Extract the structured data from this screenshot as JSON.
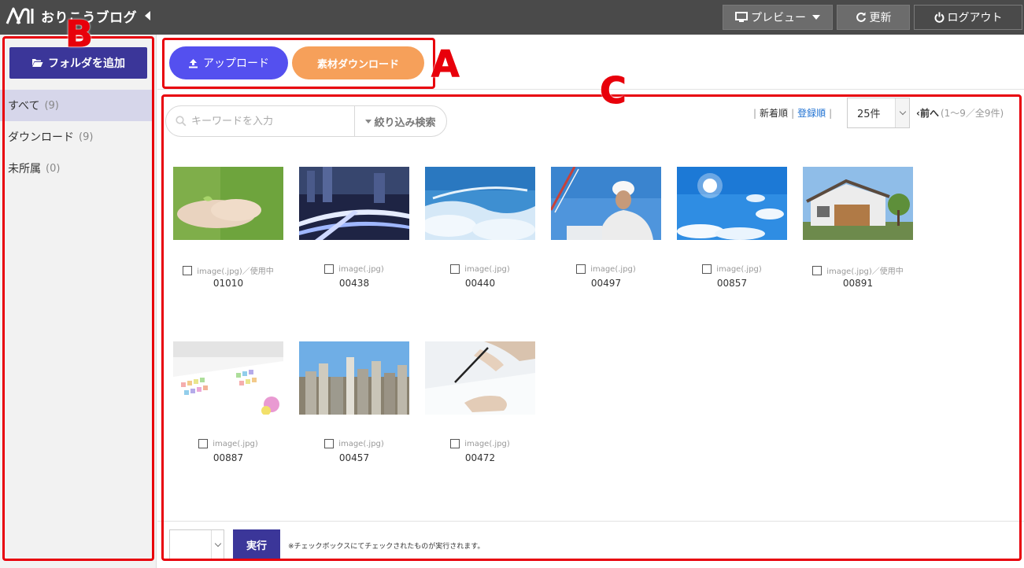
{
  "app": {
    "brand": "おりこうブログ"
  },
  "topbar": {
    "preview_label": "プレビュー",
    "refresh_label": "更新",
    "logout_label": "ログアウト"
  },
  "sidebar": {
    "add_folder_label": "フォルダを追加",
    "folders": [
      {
        "label": "すべて",
        "count": "(9)",
        "active": true
      },
      {
        "label": "ダウンロード",
        "count": "(9)",
        "active": false
      },
      {
        "label": "未所属",
        "count": "(0)",
        "active": false
      }
    ]
  },
  "actions": {
    "upload_label": "アップロード",
    "download_label": "素材ダウンロード"
  },
  "toolbar": {
    "search_placeholder": "キーワードを入力",
    "filter_label": "絞り込み検索",
    "sort_newest": "新着順",
    "sort_registered": "登録順",
    "per_page": "25件",
    "prev_label": "前へ",
    "page_info": "(1〜9／全9件)"
  },
  "images": [
    {
      "type": "image(.jpg)／使用中",
      "name": "01010",
      "art": "hands"
    },
    {
      "type": "image(.jpg)",
      "name": "00438",
      "art": "night-city"
    },
    {
      "type": "image(.jpg)",
      "name": "00440",
      "art": "clouds"
    },
    {
      "type": "image(.jpg)",
      "name": "00497",
      "art": "worker"
    },
    {
      "type": "image(.jpg)",
      "name": "00857",
      "art": "sky-sun"
    },
    {
      "type": "image(.jpg)／使用中",
      "name": "00891",
      "art": "house"
    },
    {
      "type": "image(.jpg)",
      "name": "00887",
      "art": "charts-paper"
    },
    {
      "type": "image(.jpg)",
      "name": "00457",
      "art": "city-aerial"
    },
    {
      "type": "image(.jpg)",
      "name": "00472",
      "art": "pen-writing"
    }
  ],
  "bulk": {
    "execute_label": "実行",
    "note": "※チェックボックスにてチェックされたものが実行されます。"
  },
  "annotations": {
    "a": "A",
    "b": "B",
    "c": "C"
  },
  "colors": {
    "topbar": "#4a4a4a",
    "primary": "#3b3699",
    "upload": "#5450ef",
    "download": "#f6a05a",
    "annotation": "#e8000b",
    "sort_active": "#1a6ed1"
  }
}
